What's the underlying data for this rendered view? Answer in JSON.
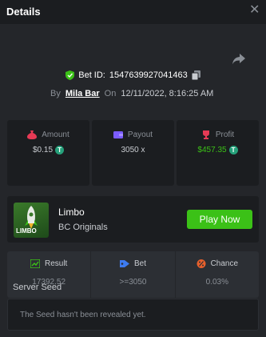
{
  "header": {
    "title": "Details",
    "close_glyph": "✕"
  },
  "bet": {
    "id_label": "Bet ID:",
    "id": "1547639927041463",
    "by_label": "By",
    "username": "Mila Bar",
    "on_label": "On",
    "timestamp": "12/11/2022, 8:16:25 AM"
  },
  "stats": [
    {
      "label": "Amount",
      "value": "$0.15",
      "icon": "money-bag-icon",
      "has_coin": true,
      "color": "#e63a55"
    },
    {
      "label": "Payout",
      "value": "3050 x",
      "icon": "wallet-icon",
      "has_coin": false,
      "color": "#7b5cff"
    },
    {
      "label": "Profit",
      "value": "$457.35",
      "icon": "trophy-icon",
      "has_coin": true,
      "color": "#e63a55"
    }
  ],
  "game": {
    "name": "Limbo",
    "provider": "BC Originals",
    "play_label": "Play Now",
    "thumb_text": "LIMBO"
  },
  "results": [
    {
      "label": "Result",
      "value": "17392.52",
      "icon": "chart-icon"
    },
    {
      "label": "Bet",
      "value": ">=3050",
      "icon": "tag-icon"
    },
    {
      "label": "Chance",
      "value": "0.03%",
      "icon": "percent-icon"
    }
  ],
  "seed": {
    "label": "Server Seed",
    "message": "The Seed hasn't been revealed yet."
  },
  "colors": {
    "accent_green": "#3bc117",
    "tether": "#26a17b",
    "bg": "#24262a",
    "panel": "#1b1d20"
  }
}
